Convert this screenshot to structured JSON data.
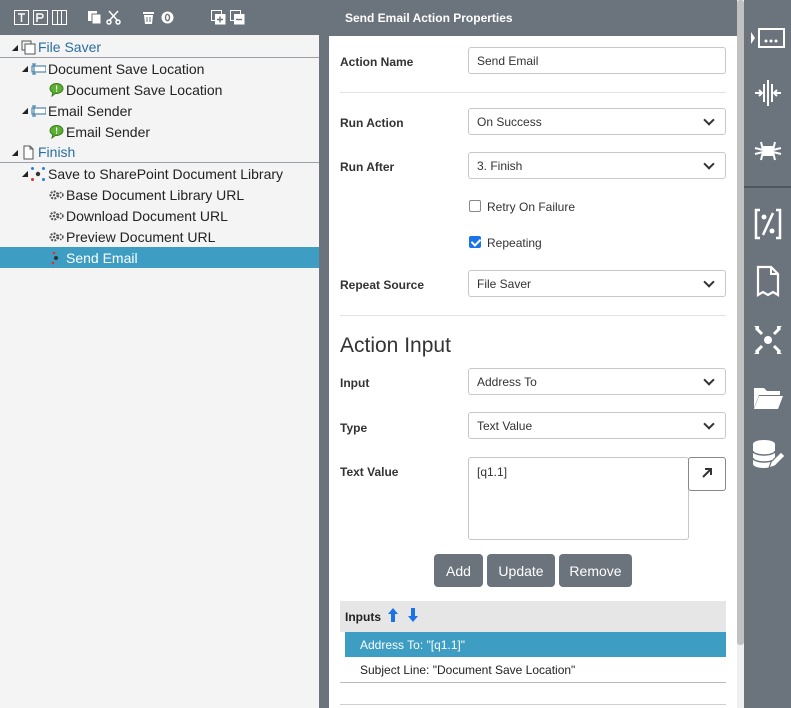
{
  "left_toolbar": {
    "icons": [
      "text-icon",
      "textbox-icon",
      "columns-icon",
      "copy-icon",
      "cut-icon",
      "delete-icon",
      "clear-icon",
      "expand-all-icon",
      "collapse-all-icon"
    ]
  },
  "tree": [
    {
      "label": "File Saver",
      "level": 0,
      "icon": "form-icon",
      "expanded": true,
      "style": "blue"
    },
    {
      "label": "Document Save Location",
      "level": 1,
      "icon": "field-icon",
      "expanded": true
    },
    {
      "label": "Document Save Location",
      "level": 2,
      "icon": "comment-icon"
    },
    {
      "label": "Email Sender",
      "level": 1,
      "icon": "field-icon",
      "expanded": true
    },
    {
      "label": "Email Sender",
      "level": 2,
      "icon": "comment-icon"
    },
    {
      "label": "Finish",
      "level": 0,
      "icon": "page-icon",
      "expanded": true,
      "style": "blue"
    },
    {
      "label": "Save to SharePoint Document Library",
      "level": 1,
      "icon": "action-icon",
      "expanded": true
    },
    {
      "label": "Base Document Library URL",
      "level": 2,
      "icon": "gears-icon"
    },
    {
      "label": "Download Document URL",
      "level": 2,
      "icon": "gears-icon"
    },
    {
      "label": "Preview Document URL",
      "level": 2,
      "icon": "gears-icon"
    },
    {
      "label": "Send Email",
      "level": 2,
      "icon": "action-icon",
      "selected": true
    }
  ],
  "props": {
    "header": "Send Email Action Properties",
    "action_name_label": "Action Name",
    "action_name_value": "Send Email",
    "run_action_label": "Run Action",
    "run_action_value": "On Success",
    "run_after_label": "Run After",
    "run_after_value": "3. Finish",
    "retry_label": "Retry On Failure",
    "retry_checked": false,
    "repeating_label": "Repeating",
    "repeating_checked": true,
    "repeat_source_label": "Repeat Source",
    "repeat_source_value": "File Saver",
    "section_title": "Action Input",
    "input_label": "Input",
    "input_value": "Address To",
    "type_label": "Type",
    "type_value": "Text Value",
    "text_value_label": "Text Value",
    "text_value": "[q1.1]",
    "add_label": "Add",
    "update_label": "Update",
    "remove_label": "Remove",
    "inputs_header": "Inputs",
    "inputs": [
      {
        "text": "Address To: \"[q1.1]\"",
        "selected": true
      },
      {
        "text": "Subject Line: \"Document Save Location\"",
        "selected": false
      }
    ]
  },
  "right_toolbar": {
    "icons": [
      "textbox-field-icon",
      "split-icon",
      "merge-icon",
      "calculation-icon",
      "document-icon",
      "connect-icon",
      "folder-icon",
      "database-icon"
    ]
  },
  "colors": {
    "toolbar": "#6b737d",
    "selected": "#3d9dc3",
    "tree_blue": "#2a6f9e",
    "checkbox": "#1a73e8"
  }
}
